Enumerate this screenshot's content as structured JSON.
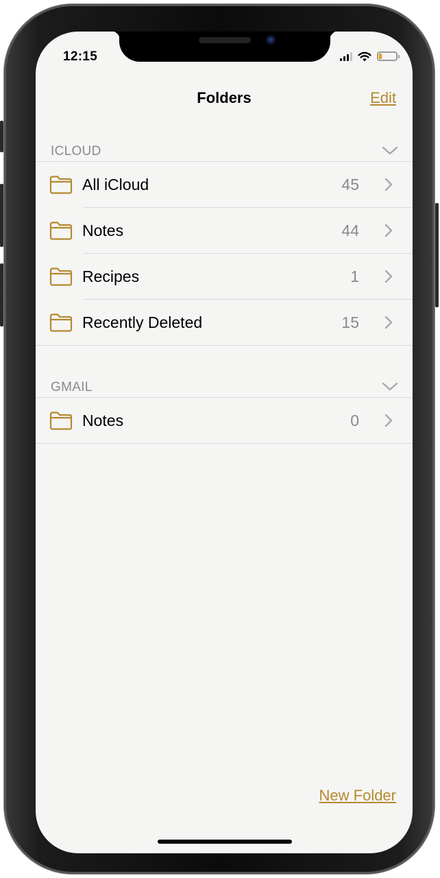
{
  "status_bar": {
    "time": "12:15",
    "signal_icon": "cellular-signal-icon",
    "wifi_icon": "wifi-icon",
    "battery_icon": "battery-low-icon",
    "battery_level": 0.18
  },
  "nav": {
    "title": "Folders",
    "edit_label": "Edit"
  },
  "sections": [
    {
      "header": "ICLOUD",
      "folders": [
        {
          "name": "All iCloud",
          "count": "45"
        },
        {
          "name": "Notes",
          "count": "44"
        },
        {
          "name": "Recipes",
          "count": "1"
        },
        {
          "name": "Recently Deleted",
          "count": "15"
        }
      ]
    },
    {
      "header": "GMAIL",
      "folders": [
        {
          "name": "Notes",
          "count": "0"
        }
      ]
    }
  ],
  "toolbar": {
    "new_folder_label": "New Folder"
  },
  "colors": {
    "accent": "#b5892f",
    "background": "#f5f5f4",
    "secondary_text": "#8a8a8e",
    "separator": "#d8d8d8",
    "battery_low": "#e59a16"
  }
}
